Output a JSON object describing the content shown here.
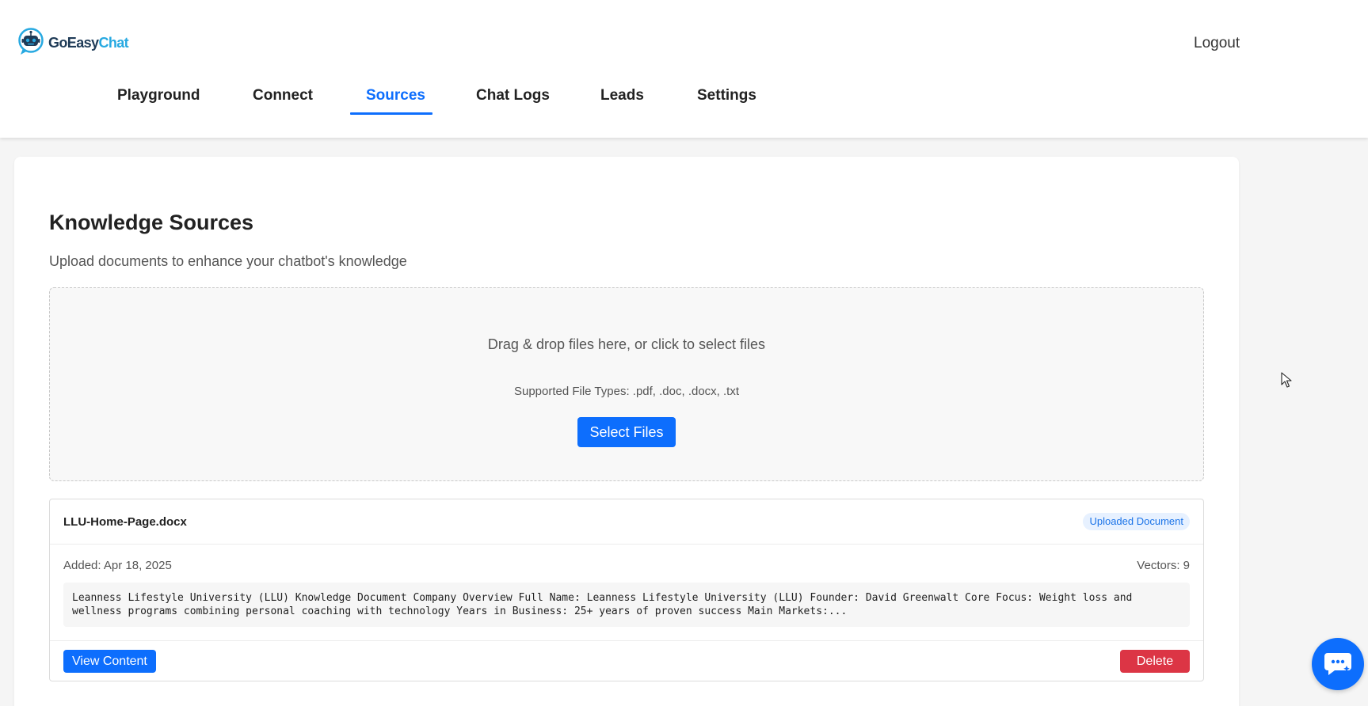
{
  "brand": {
    "part1": "GoEasy",
    "part2": "Chat",
    "logo_icon": "robot-chat-icon"
  },
  "header": {
    "logout_label": "Logout"
  },
  "tabs": [
    {
      "label": "Playground",
      "active": false
    },
    {
      "label": "Connect",
      "active": false
    },
    {
      "label": "Sources",
      "active": true
    },
    {
      "label": "Chat Logs",
      "active": false
    },
    {
      "label": "Leads",
      "active": false
    },
    {
      "label": "Settings",
      "active": false
    }
  ],
  "page": {
    "title": "Knowledge Sources",
    "subtitle": "Upload documents to enhance your chatbot's knowledge"
  },
  "dropzone": {
    "text": "Drag & drop files here, or click to select files",
    "supported": "Supported File Types: .pdf, .doc, .docx, .txt",
    "button_label": "Select Files"
  },
  "documents": [
    {
      "name": "LLU-Home-Page.docx",
      "badge": "Uploaded Document",
      "added": "Added: Apr 18, 2025",
      "vectors": "Vectors: 9",
      "preview": "Leanness Lifestyle University (LLU) Knowledge Document Company Overview Full Name: Leanness Lifestyle University (LLU) Founder: David Greenwalt Core Focus: Weight loss and wellness programs combining personal coaching with technology Years in Business: 25+ years of proven success Main Markets:...",
      "view_label": "View Content",
      "delete_label": "Delete"
    }
  ],
  "chat_widget": {
    "icon": "chat-bubble-icon"
  },
  "colors": {
    "primary": "#0d6efd",
    "danger": "#dc3545",
    "brand_dark": "#1f3b57",
    "brand_light": "#27a9e1"
  }
}
